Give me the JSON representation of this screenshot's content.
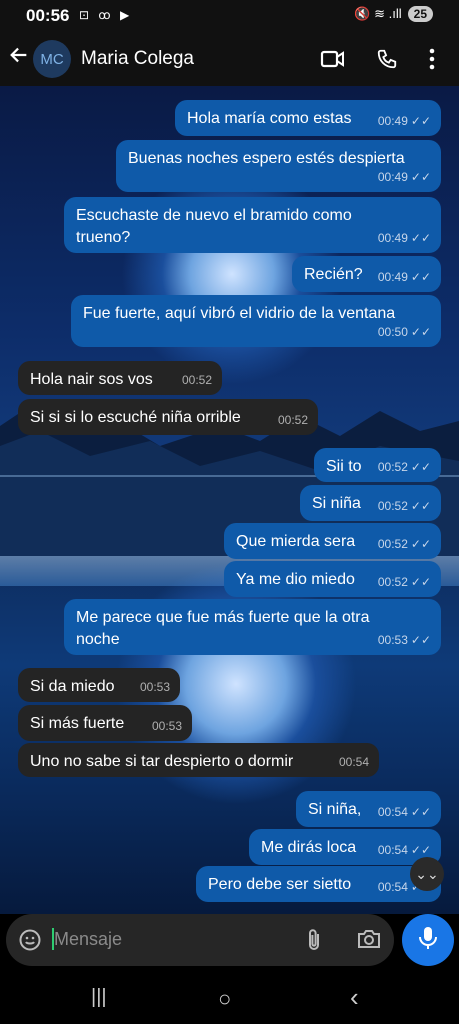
{
  "status": {
    "time": "00:56",
    "icons": "⊡ ꝏ ▶",
    "right_icons": "🔇 ≋ .ıll",
    "battery": "25"
  },
  "header": {
    "back_icon": "arrow-left-icon",
    "avatar_initials": "MC",
    "contact_name": "Maria Colega",
    "icons": [
      "video-call-icon",
      "phone-icon",
      "more-vert-icon"
    ]
  },
  "messages": [
    {
      "dir": "out",
      "text": "Hola maría como estas",
      "time": "00:49",
      "read": true
    },
    {
      "dir": "out",
      "text": "Buenas noches espero estés despierta",
      "time": "00:49",
      "read": true
    },
    {
      "dir": "out",
      "text": "Escuchaste de nuevo el bramido como trueno?",
      "time": "00:49",
      "read": true
    },
    {
      "dir": "out",
      "text": "Recién?",
      "time": "00:49",
      "read": true
    },
    {
      "dir": "out",
      "text": "Fue fuerte, aquí vibró el vidrio de la ventana",
      "time": "00:50",
      "read": true
    },
    {
      "dir": "in",
      "text": "Hola nair sos vos",
      "time": "00:52"
    },
    {
      "dir": "in",
      "text": "Si si si lo escuché niña orrible",
      "time": "00:52"
    },
    {
      "dir": "out",
      "text": "Sii to",
      "time": "00:52",
      "read": true
    },
    {
      "dir": "out",
      "text": "Si niña",
      "time": "00:52",
      "read": true
    },
    {
      "dir": "out",
      "text": "Que mierda sera",
      "time": "00:52",
      "read": true
    },
    {
      "dir": "out",
      "text": "Ya me dio miedo",
      "time": "00:52",
      "read": true
    },
    {
      "dir": "out",
      "text": "Me parece que fue más fuerte que la otra noche",
      "time": "00:53",
      "read": true
    },
    {
      "dir": "in",
      "text": "Si da miedo",
      "time": "00:53"
    },
    {
      "dir": "in",
      "text": "Si más fuerte",
      "time": "00:53"
    },
    {
      "dir": "in",
      "text": "Uno no sabe si tar despierto o dormir",
      "time": "00:54"
    },
    {
      "dir": "out",
      "text": "Si niña,",
      "time": "00:54",
      "read": true
    },
    {
      "dir": "out",
      "text": "Me dirás loca",
      "time": "00:54",
      "read": true
    },
    {
      "dir": "out",
      "text": "Pero debe ser sietto",
      "time": "00:54",
      "read": true
    }
  ],
  "composer": {
    "placeholder": "Mensaje",
    "icons": [
      "sticker-icon",
      "attach-icon",
      "camera-icon",
      "mic-icon"
    ]
  },
  "navbar": {
    "recent": "|||",
    "home": "○",
    "back": "‹"
  },
  "colors": {
    "outgoing": "#0f5aa9",
    "incoming": "#242424",
    "accent": "#1976e6"
  }
}
